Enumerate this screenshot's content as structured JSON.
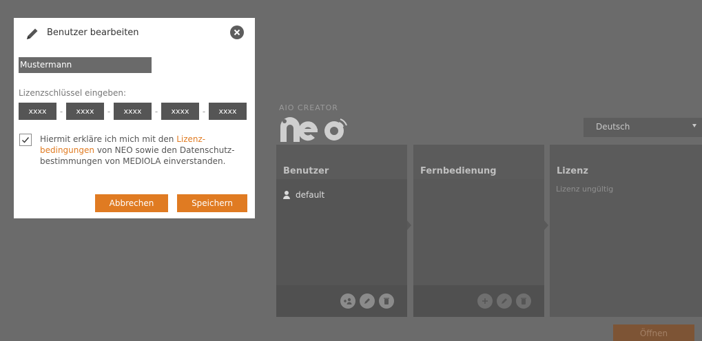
{
  "background": {
    "brand_top": "AIO CREATOR",
    "brand_logo_text": "neo",
    "language": "Deutsch",
    "columns": [
      {
        "title": "Benutzer"
      },
      {
        "title": "Fernbedienung"
      },
      {
        "title": "Lizenz",
        "status": "Lizenz ungültig"
      }
    ],
    "users": [
      {
        "name": "default"
      }
    ],
    "open_button": "Öffnen"
  },
  "dialog": {
    "title": "Benutzer bearbeiten",
    "name_value": "Mustermann",
    "key_label": "Lizenzschlüssel eingeben:",
    "key_fields": [
      "xxxx",
      "xxxx",
      "xxxx",
      "xxxx",
      "xxxx"
    ],
    "key_separator": "-",
    "terms_checked": true,
    "terms": {
      "line1_pre": "Hiermit erkläre ich mich mit den ",
      "line1_link": "Lizenz-",
      "line2_link": "bedingungen",
      "line2_post": " von NEO sowie den Datenschutz-",
      "line3": "bestimmungen von MEDIOLA einverstanden."
    },
    "cancel_label": "Abbrechen",
    "save_label": "Speichern"
  },
  "colors": {
    "accent": "#e07b22",
    "overlay_bg": "#6b6b6b",
    "dialog_bg": "#ffffff"
  },
  "icons": [
    "pencil-icon",
    "close-icon",
    "user-icon",
    "add-user-icon",
    "edit-icon",
    "trash-icon",
    "add-icon",
    "checkmark-icon"
  ]
}
